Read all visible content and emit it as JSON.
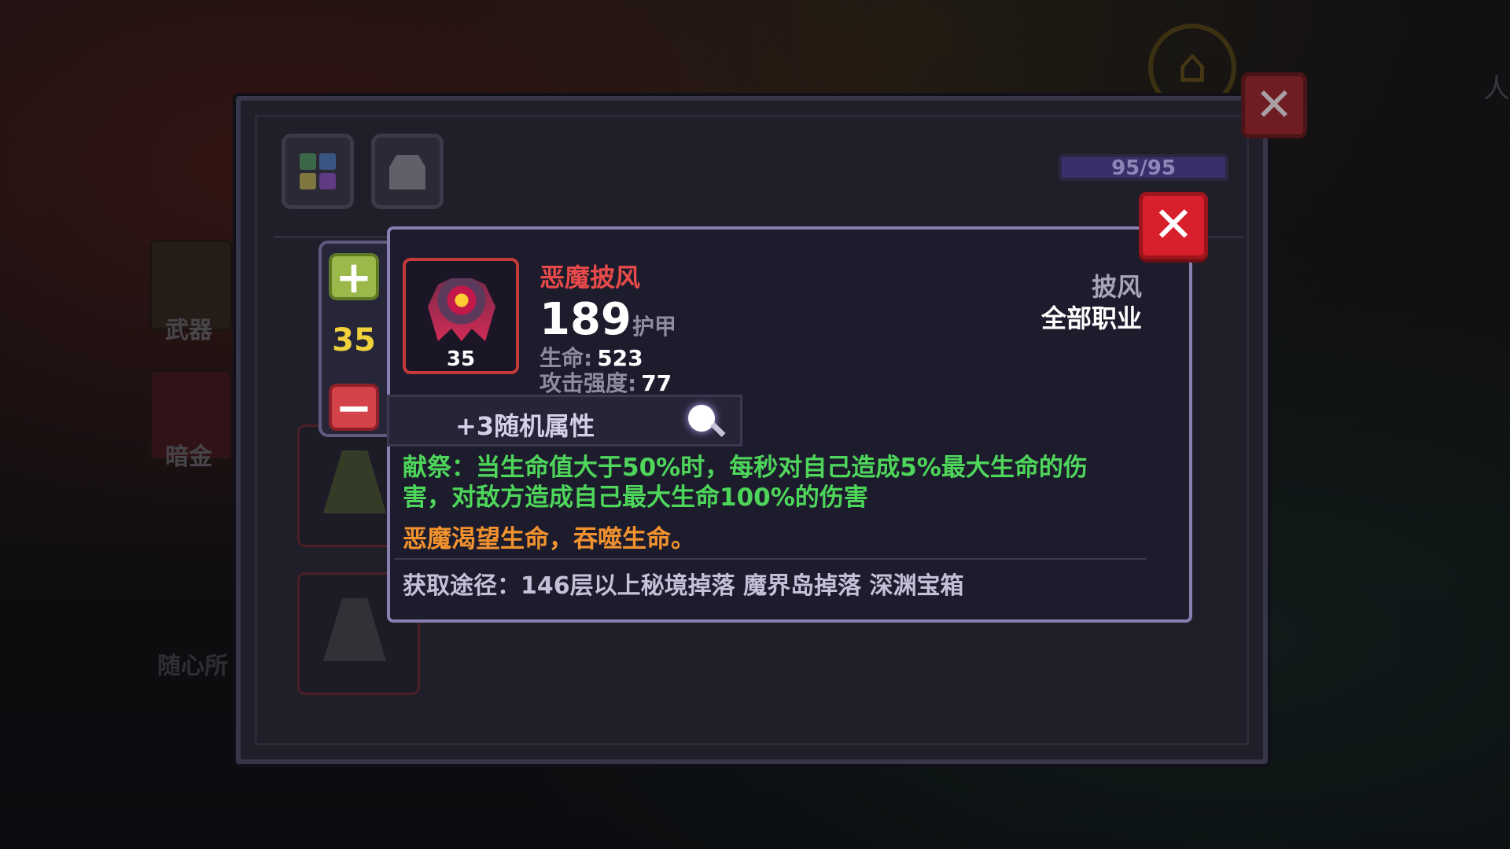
{
  "background": {
    "world_labels": [
      "武器",
      "暗金",
      "随心所"
    ],
    "corner_text": "人"
  },
  "main_panel": {
    "tabs": [
      {
        "name": "tab-all-items",
        "icon": "grid-icon"
      },
      {
        "name": "tab-armor",
        "icon": "armor-icon"
      }
    ],
    "capacity": "95/95",
    "close_label": "✕"
  },
  "level_control": {
    "plus_label": "+",
    "value": "35",
    "minus_label": "−"
  },
  "tooltip": {
    "close_label": "✕",
    "item": {
      "icon": "demon-cloak-icon",
      "level": "35",
      "name": "恶魔披风",
      "main_value": "189",
      "main_label": "护甲",
      "type": "披风",
      "class": "全部职业",
      "stats": [
        {
          "label": "生命:",
          "value": "523"
        },
        {
          "label": "攻击强度:",
          "value": "77"
        }
      ]
    },
    "random_attr": "+3随机属性",
    "effect_text": "献祭：当生命值大于50%时，每秒对自己造成5%最大生命的伤害，对敌方造成自己最大生命100%的伤害",
    "flavor_text": "恶魔渴望生命，吞噬生命。",
    "source_text": "获取途径：146层以上秘境掉落 魔界岛掉落 深渊宝箱"
  },
  "colors": {
    "item_name": "#e84a4a",
    "effect": "#4ed65a",
    "flavor": "#f2922e",
    "level_value": "#f1d23c",
    "close_button": "#d8202c"
  }
}
